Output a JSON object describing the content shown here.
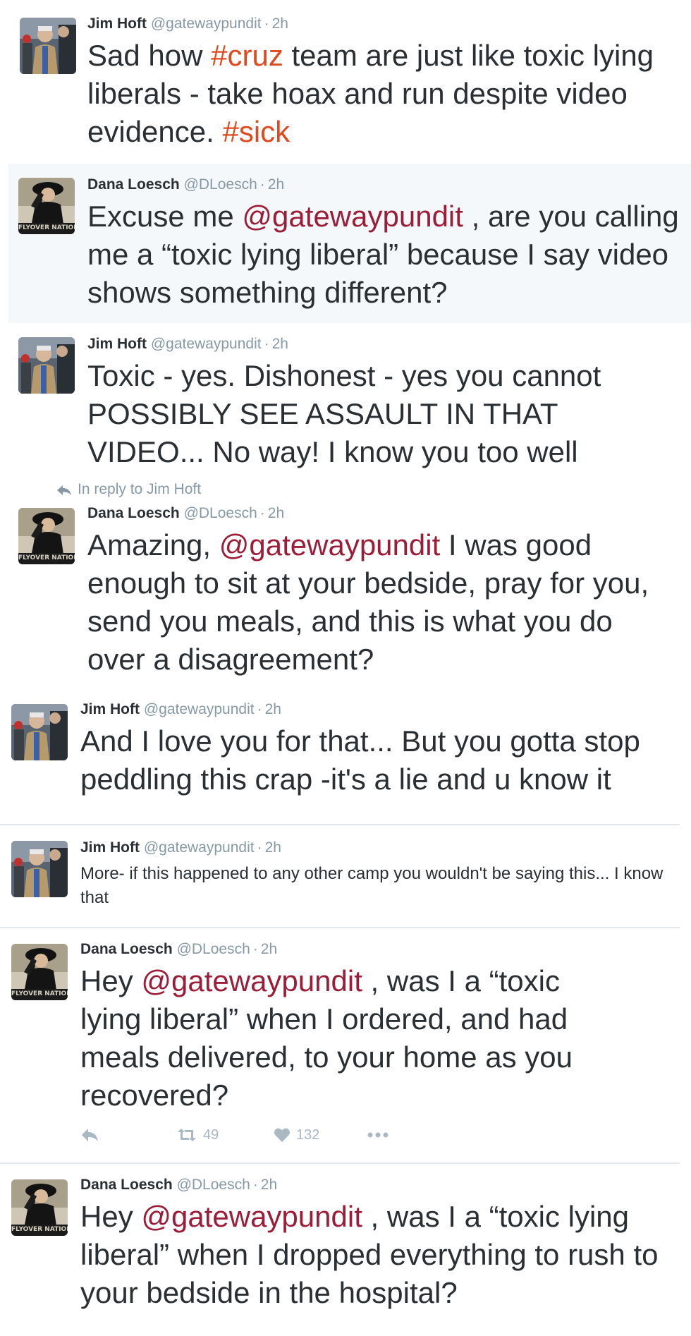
{
  "reply_context": "In reply to Jim Hoft",
  "tweets": [
    {
      "name": "Jim Hoft",
      "handle": "@gatewaypundit",
      "time": "2h",
      "text_parts": [
        "Sad how ",
        "#cruz",
        " team are just like toxic lying liberals - take hoax and run despite video evidence. ",
        "#sick"
      ]
    },
    {
      "name": "Dana Loesch",
      "handle": "@DLoesch",
      "time": "2h",
      "text_parts": [
        "Excuse me ",
        "@gatewaypundit",
        " , are you calling me a “toxic lying liberal” because I say video shows something different?"
      ]
    },
    {
      "name": "Jim Hoft",
      "handle": "@gatewaypundit",
      "time": "2h",
      "text": "Toxic - yes. Dishonest - yes you cannot POSSIBLY SEE ASSAULT IN THAT VIDEO... No way! I know you too well"
    },
    {
      "name": "Dana Loesch",
      "handle": "@DLoesch",
      "time": "2h",
      "text_parts": [
        "Amazing, ",
        "@gatewaypundit",
        " I was good enough to sit at your bedside, pray for you, send you meals, and this is what you do over a disagreement?"
      ]
    },
    {
      "name": "Jim Hoft",
      "handle": "@gatewaypundit",
      "time": "2h",
      "text": "And I love you for that... But you gotta stop peddling this crap -it's a lie and u know it"
    },
    {
      "name": "Jim Hoft",
      "handle": "@gatewaypundit",
      "time": "2h",
      "text": "More- if this happened to any other camp you wouldn't be saying this... I know that"
    },
    {
      "name": "Dana Loesch",
      "handle": "@DLoesch",
      "time": "2h",
      "text_parts": [
        "Hey ",
        "@gatewaypundit",
        " , was I a “toxic lying liberal” when I ordered, and had meals delivered, to your home as you recovered?"
      ],
      "retweets": "49",
      "likes": "132"
    },
    {
      "name": "Dana Loesch",
      "handle": "@DLoesch",
      "time": "2h",
      "text_parts": [
        "Hey ",
        "@gatewaypundit",
        " , was I a “toxic lying liberal” when I dropped everything to rush to your bedside in the hospital?"
      ]
    }
  ],
  "avatars": {
    "jim": "Jim Hoft",
    "dana_caption": "FLYOVER NATION"
  },
  "colors": {
    "hashtag": "#e0491e",
    "mention": "#9c1d38",
    "meta": "#8899a6",
    "highlight_bg": "#f5f8fa"
  },
  "icons": [
    "reply-icon",
    "retweet-icon",
    "like-icon",
    "more-icon"
  ]
}
